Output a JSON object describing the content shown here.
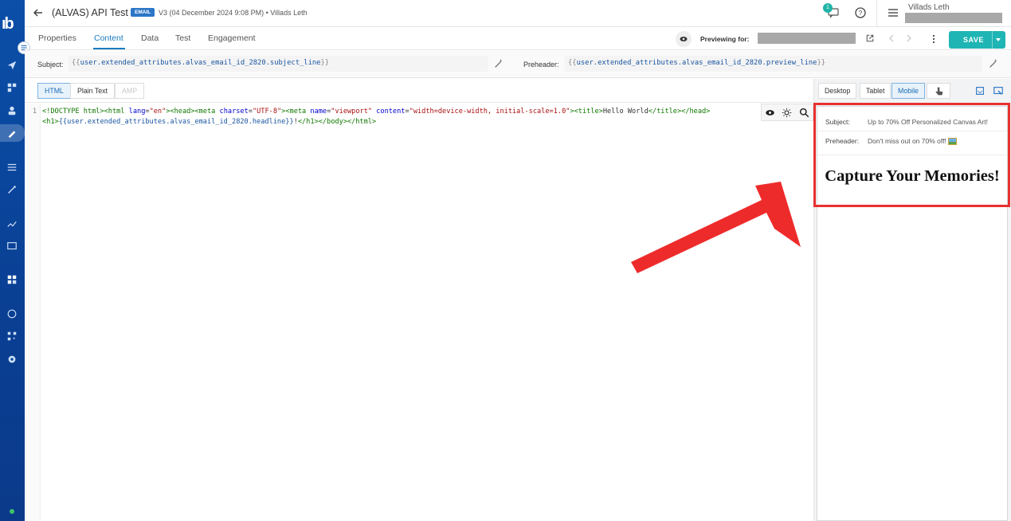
{
  "header": {
    "title": "(ALVAS) API Test",
    "badge": "EMAIL",
    "version": "V3 (04 December 2024 9:08 PM) • Villads Leth",
    "notification_count": "1",
    "user_name": "Villads Leth"
  },
  "tabs": [
    {
      "label": "Properties"
    },
    {
      "label": "Content"
    },
    {
      "label": "Data"
    },
    {
      "label": "Test"
    },
    {
      "label": "Engagement"
    }
  ],
  "previewing_label": "Previewing for:",
  "save_label": "SAVE",
  "subject": {
    "label": "Subject:",
    "value": "user.extended_attributes.alvas_email_id_2820.subject_line"
  },
  "preheader": {
    "label": "Preheader:",
    "value": "user.extended_attributes.alvas_email_id_2820.preview_line"
  },
  "editor_modes": [
    {
      "label": "HTML"
    },
    {
      "label": "Plain Text"
    },
    {
      "label": "AMP"
    }
  ],
  "code": {
    "line_number": "1",
    "title_text": "Hello World",
    "headline_var": "user.extended_attributes.alvas_email_id_2820.headline"
  },
  "devices": [
    {
      "label": "Desktop"
    },
    {
      "label": "Tablet"
    },
    {
      "label": "Mobile"
    }
  ],
  "preview": {
    "subject_label": "Subject:",
    "subject_value": "Up to 70% Off Personalized Canvas Art!",
    "preheader_label": "Preheader:",
    "preheader_value": "Don't miss out on 70% off!",
    "headline": "Capture Your Memories!"
  },
  "colors": {
    "accent": "#1a7cc0",
    "save": "#1fb5b4",
    "annotation": "#e83030",
    "rail": "#0b4fa8"
  }
}
